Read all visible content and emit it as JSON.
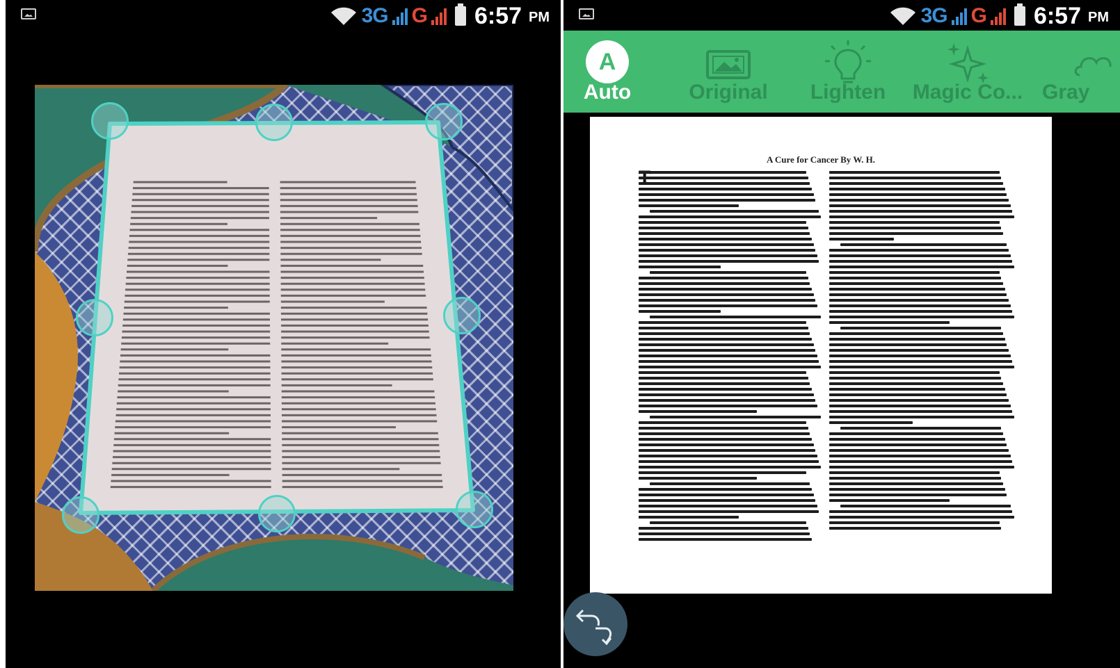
{
  "status_bar": {
    "network": "3G",
    "network2": "G",
    "time": "6:57",
    "ampm": "PM"
  },
  "left_screen": {
    "icons": [
      "picture-notification-icon",
      "wifi-icon",
      "signal-icon",
      "battery-icon"
    ],
    "crop_handles": [
      "top-left",
      "top-center",
      "top-right",
      "middle-left",
      "middle-right",
      "bottom-left",
      "bottom-center",
      "bottom-right"
    ]
  },
  "right_screen": {
    "filters": [
      {
        "label": "Auto",
        "icon": "A",
        "active": true
      },
      {
        "label": "Original",
        "icon": "image-icon",
        "active": false
      },
      {
        "label": "Lighten",
        "icon": "lightbulb-icon",
        "active": false
      },
      {
        "label": "Magic Co...",
        "icon": "sparkle-icon",
        "active": false
      },
      {
        "label": "Gray",
        "icon": "cloud-icon",
        "active": false
      }
    ],
    "document_title": "A Cure for Cancer  By W. H.",
    "rotate_icon": "rotate-icon"
  },
  "colors": {
    "accent_green": "#42ba70",
    "crop_cyan": "#4fd1c5",
    "signal_blue": "#3d8fd6",
    "signal_red": "#e04a3a"
  }
}
